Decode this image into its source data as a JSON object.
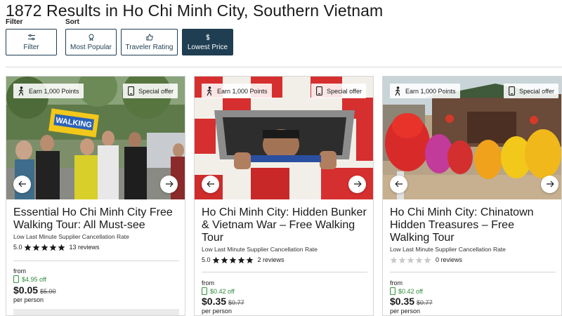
{
  "page": {
    "title": "1872 Results in Ho Chi Minh City, Southern Vietnam"
  },
  "filter": {
    "label": "Filter",
    "button_label": "Filter"
  },
  "sort": {
    "label": "Sort",
    "options": [
      {
        "label": "Most Popular",
        "icon": "popular-icon",
        "selected": false
      },
      {
        "label": "Traveler Rating",
        "icon": "thumbs-up-icon",
        "selected": false
      },
      {
        "label": "Lowest Price",
        "icon": "dollar-icon",
        "selected": true
      }
    ]
  },
  "colors": {
    "accent": "#1f3e52",
    "discount": "#2e8b3a",
    "star": "#1a1a1a",
    "star_empty": "#c9c9c9"
  },
  "cards": [
    {
      "points_label": "Earn 1,000 Points",
      "offer_label": "Special offer",
      "title": "Essential Ho Chi Minh City Free Walking Tour: All Must-see",
      "supplier": "Low Last Minute Supplier Cancellation Rate",
      "rating_score": "5.0",
      "stars": 5,
      "reviews": "13 reviews",
      "from_label": "from",
      "discount": "$4.95 off",
      "price": "$0.05",
      "original_price": "$5.00",
      "per_label": "per person",
      "image_sign": "WALKING"
    },
    {
      "points_label": "Earn 1,000 Points",
      "offer_label": "Special offer",
      "title": "Ho Chi Minh City: Hidden Bunker & Vietnam War – Free Walking Tour",
      "supplier": "Low Last Minute Supplier Cancellation Rate",
      "rating_score": "5.0",
      "stars": 5,
      "reviews": "2 reviews",
      "from_label": "from",
      "discount": "$0.42 off",
      "price": "$0.35",
      "original_price": "$0.77",
      "per_label": "per person"
    },
    {
      "points_label": "Earn 1,000 Points",
      "offer_label": "Special offer",
      "title": "Ho Chi Minh City: Chinatown Hidden Treasures – Free Walking Tour",
      "supplier": "Low Last Minute Supplier Cancellation Rate",
      "rating_score": "",
      "stars": 0,
      "reviews": "0 reviews",
      "from_label": "from",
      "discount": "$0.42 off",
      "price": "$0.35",
      "original_price": "$0.77",
      "per_label": "per person"
    }
  ]
}
